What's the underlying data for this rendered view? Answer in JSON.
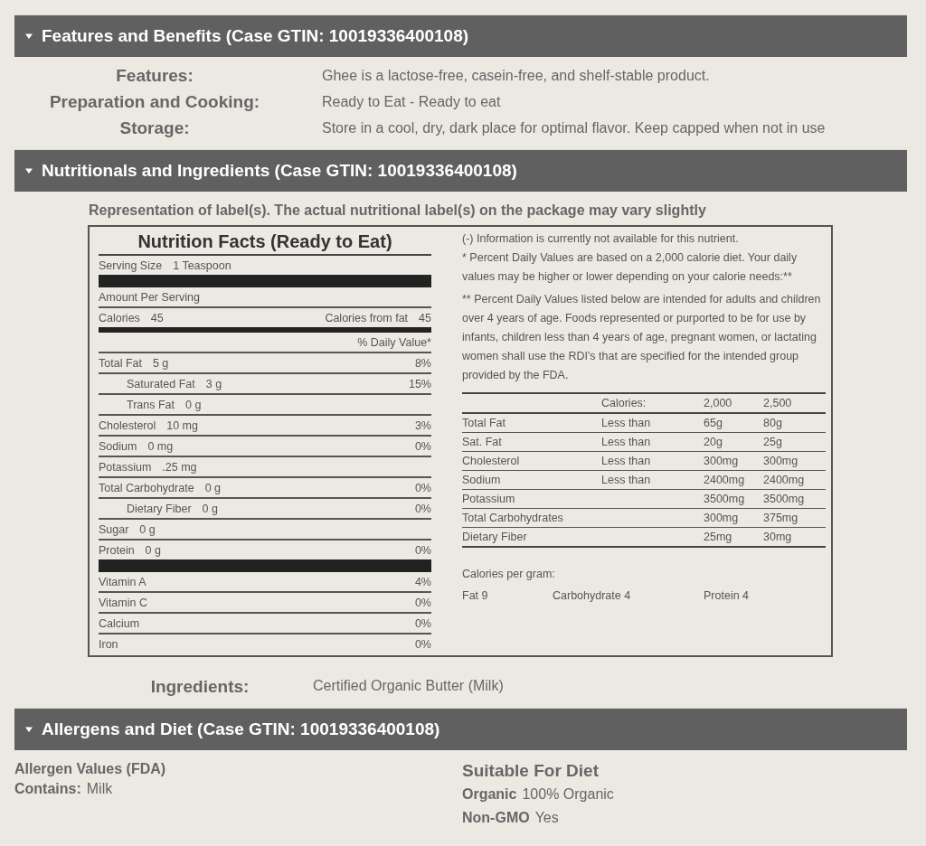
{
  "sections": [
    {
      "title": "Features and Benefits (Case GTIN: 10019336400108)",
      "expanded": true,
      "kind": "features",
      "rows": [
        {
          "label": "Features:",
          "value": "Ghee is a lactose-free, casein-free, and shelf-stable product."
        },
        {
          "label": "Preparation and Cooking:",
          "value": "Ready to Eat - Ready to eat"
        },
        {
          "label": "Storage:",
          "value": "Store in a cool, dry, dark place for optimal flavor. Keep capped when not in use"
        }
      ]
    },
    {
      "title": "Nutritionals and Ingredients (Case GTIN: 10019336400108)",
      "expanded": true,
      "kind": "nutrition",
      "note": "Representation of label(s). The actual nutritional label(s) on the package may vary slightly",
      "label": {
        "title": "Nutrition Facts (Ready to Eat)",
        "serving": {
          "label": "Serving Size",
          "value": "1 Teaspoon"
        },
        "amount_per_serving": "Amount Per Serving",
        "calories": {
          "label": "Calories",
          "value": "45",
          "fat_label": "Calories from fat",
          "fat_value": "45"
        },
        "daily_value_heading": "% Daily Value*",
        "nutrients": [
          {
            "name": "Total Fat",
            "amount": "5 g",
            "dv": "8%",
            "indent": false
          },
          {
            "name": "Saturated Fat",
            "amount": "3 g",
            "dv": "15%",
            "indent": true
          },
          {
            "name": "Trans Fat",
            "amount": "0 g",
            "indent": true
          },
          {
            "name": "Cholesterol",
            "amount": "10 mg",
            "dv": "3%",
            "indent": false
          },
          {
            "name": "Sodium",
            "amount": "0 mg",
            "dv": "0%",
            "indent": false
          },
          {
            "name": "Potassium",
            "amount": ".25 mg",
            "indent": false
          },
          {
            "name": "Total Carbohydrate",
            "amount": "0 g",
            "dv": "0%",
            "indent": false
          },
          {
            "name": "Dietary Fiber",
            "amount": "0 g",
            "dv": "0%",
            "indent": true
          },
          {
            "name": "Sugar",
            "amount": "0 g",
            "indent": false
          },
          {
            "name": "Protein",
            "amount": "0 g",
            "dv": "0%",
            "indent": false
          }
        ],
        "vitamins": [
          {
            "name": "Vitamin A",
            "dv": "4%"
          },
          {
            "name": "Vitamin C",
            "dv": "0%"
          },
          {
            "name": "Calcium",
            "dv": "0%"
          },
          {
            "name": "Iron",
            "dv": "0%"
          }
        ],
        "notes": [
          "(-) Information is currently not available for this nutrient.",
          "* Percent Daily Values are based on a 2,000 calorie diet. Your daily values may be higher or lower depending on your calorie needs:**",
          "** Percent Daily Values listed below are intended for adults and children over 4 years of age. Foods represented or purported to be for use by infants, children less than 4 years of age, pregnant women, or lactating women shall use the RDI's that are specified for the intended group provided by the FDA."
        ],
        "dv_table": {
          "header": [
            "Calories:",
            "2,000",
            "2,500"
          ],
          "rows": [
            [
              "Total Fat",
              "Less than",
              "65g",
              "80g"
            ],
            [
              "Sat. Fat",
              "Less than",
              "20g",
              "25g"
            ],
            [
              "Cholesterol",
              "Less than",
              "300mg",
              "300mg"
            ],
            [
              "Sodium",
              "Less than",
              "2400mg",
              "2400mg"
            ],
            [
              "Potassium",
              "",
              "3500mg",
              "3500mg"
            ],
            [
              "Total Carbohydrates",
              "",
              "300mg",
              "375mg"
            ],
            [
              "Dietary Fiber",
              "",
              "25mg",
              "30mg"
            ]
          ]
        },
        "calories_per_gram": {
          "heading": "Calories per gram:",
          "items": [
            "Fat 9",
            "Carbohydrate 4",
            "Protein 4"
          ]
        }
      },
      "ingredients": {
        "label": "Ingredients:",
        "value": "Certified Organic Butter (Milk)"
      }
    },
    {
      "title": "Allergens and Diet (Case GTIN: 10019336400108)",
      "expanded": true,
      "kind": "allergens",
      "allergen_heading": "Allergen Values (FDA)",
      "allergens": [
        {
          "label": "Contains:",
          "value": "Milk"
        }
      ],
      "diet_heading": "Suitable For Diet",
      "diets": [
        {
          "label": "Organic",
          "value": "100% Organic"
        },
        {
          "label": "Non-GMO",
          "value": "Yes"
        }
      ]
    }
  ]
}
